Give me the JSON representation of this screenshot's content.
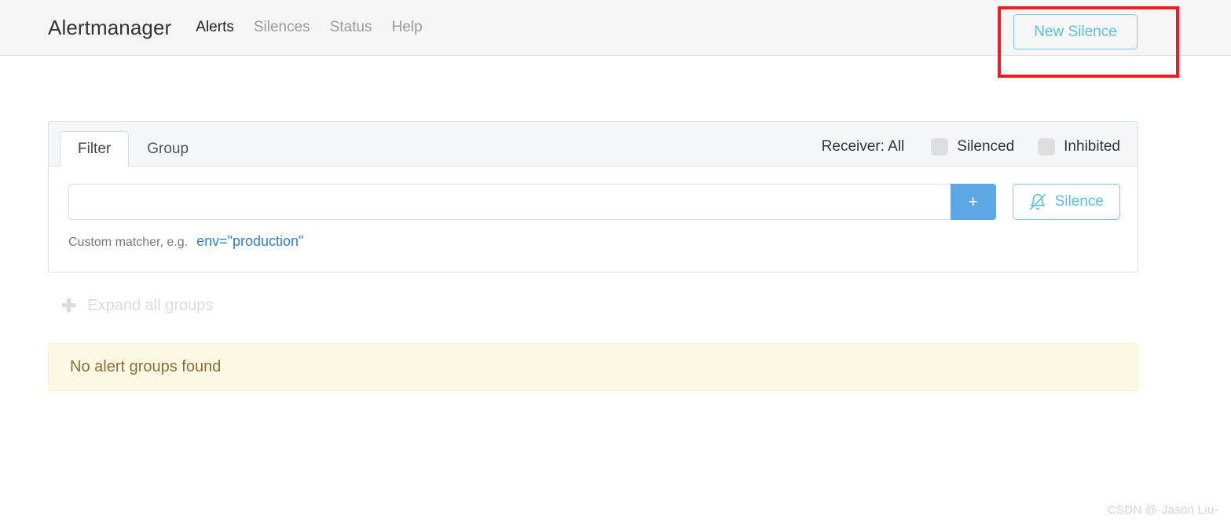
{
  "navbar": {
    "brand": "Alertmanager",
    "links": [
      {
        "label": "Alerts",
        "active": true
      },
      {
        "label": "Silences",
        "active": false
      },
      {
        "label": "Status",
        "active": false
      },
      {
        "label": "Help",
        "active": false
      }
    ],
    "new_silence_label": "New Silence",
    "accent_color": "#5bc0de",
    "background_color": "#f5f5f5"
  },
  "annotation": {
    "shape": "rectangle",
    "color": "#ee1c25",
    "targets": "new-silence-button"
  },
  "filter_card": {
    "tabs": [
      {
        "label": "Filter",
        "active": true
      },
      {
        "label": "Group",
        "active": false
      }
    ],
    "receiver_label": "Receiver: All",
    "toggles": [
      {
        "label": "Silenced",
        "checked": false
      },
      {
        "label": "Inhibited",
        "checked": false
      }
    ],
    "matcher_input": {
      "value": "",
      "placeholder": ""
    },
    "add_button_label": "+",
    "silence_button_label": "Silence",
    "silence_button_icon": "bell-slash-icon",
    "hint_label": "Custom matcher, e.g.",
    "hint_code": "env=\"production\"",
    "hint_code_color": "#2d7fd3"
  },
  "expand_all": {
    "icon": "plus-icon",
    "label": "Expand all groups",
    "color": "#dcdcdc"
  },
  "empty_state": {
    "message": "No alert groups found",
    "background_color": "#fcf8e3",
    "text_color": "#8a6d3b"
  },
  "watermark": {
    "text": "CSDN @-Jason Liu-"
  }
}
